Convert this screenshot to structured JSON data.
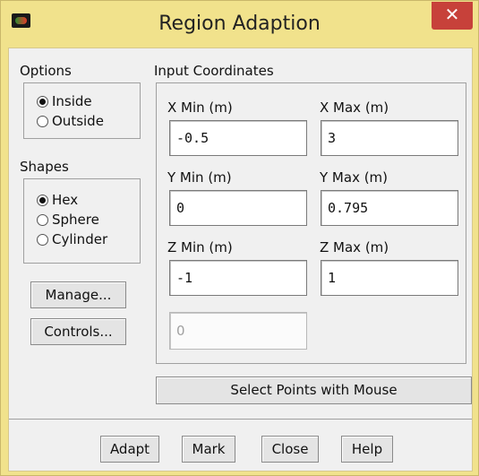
{
  "window": {
    "title": "Region Adaption",
    "close_glyph": "✕"
  },
  "options": {
    "label": "Options",
    "items": [
      {
        "label": "Inside",
        "selected": true
      },
      {
        "label": "Outside",
        "selected": false
      }
    ]
  },
  "shapes": {
    "label": "Shapes",
    "items": [
      {
        "label": "Hex",
        "selected": true
      },
      {
        "label": "Sphere",
        "selected": false
      },
      {
        "label": "Cylinder",
        "selected": false
      }
    ]
  },
  "side_buttons": {
    "manage": "Manage...",
    "controls": "Controls..."
  },
  "coords": {
    "label": "Input Coordinates",
    "xmin": {
      "label": "X Min (m)",
      "value": "-0.5"
    },
    "xmax": {
      "label": "X Max (m)",
      "value": "3"
    },
    "ymin": {
      "label": "Y Min (m)",
      "value": "0"
    },
    "ymax": {
      "label": "Y Max (m)",
      "value": "0.795"
    },
    "zmin": {
      "label": "Z Min (m)",
      "value": "-1"
    },
    "zmax": {
      "label": "Z Max (m)",
      "value": "1"
    },
    "radius": {
      "value": "0"
    }
  },
  "select_points_label": "Select Points with Mouse",
  "footer": {
    "adapt": "Adapt",
    "mark": "Mark",
    "close": "Close",
    "help": "Help"
  }
}
